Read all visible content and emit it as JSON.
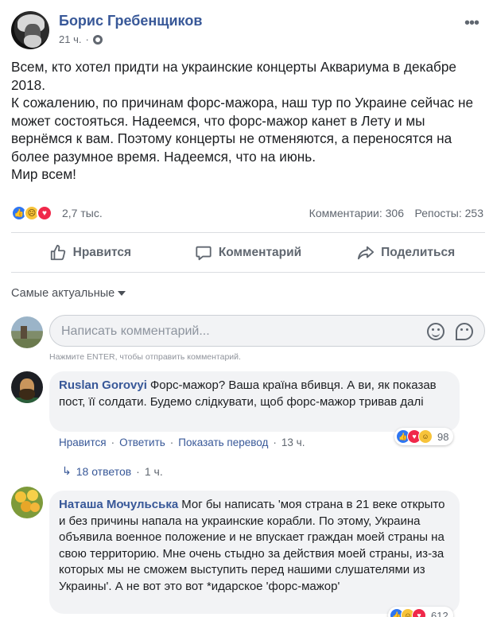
{
  "post": {
    "author": "Борис Гребенщиков",
    "time": "21 ч.",
    "meta_sep": "·",
    "text_lines": [
      "Всем, кто хотел придти на украинские концерты Аквариума в декабре 2018.",
      "К сожалению, по причинам форс-мажора, наш тур по Украине сейчас не может состояться. Надеемся, что форс-мажор канет в Лету и мы вернёмся к вам. Поэтому концерты не отменяются, а переносятся на более разумное время. Надеемся, что на июнь.",
      "Мир всем!"
    ],
    "reactions_count": "2,7 тыс.",
    "comments_count": "Комментарии: 306",
    "reposts_count": "Репосты: 253",
    "icons": [
      "like-icon",
      "sad-icon",
      "love-icon"
    ]
  },
  "actions": {
    "like": "Нравится",
    "comment": "Комментарий",
    "share": "Поделиться"
  },
  "sort_label": "Самые актуальные",
  "composer": {
    "placeholder": "Написать комментарий...",
    "hint": "Нажмите ENTER, чтобы отправить комментарий."
  },
  "comments": [
    {
      "name": "Ruslan Gorovyi",
      "text": "Форс-мажор? Ваша країна вбивця. А ви, як показав пост, її солдати. Будемо слідкувати, щоб форс-мажор тривав далі",
      "like": "Нравится",
      "reply": "Ответить",
      "translate": "Показать перевод",
      "time": "13 ч.",
      "reactions": "98",
      "replies_label": "18 ответов",
      "replies_time": "1 ч."
    },
    {
      "name": "Наташа Мочульська",
      "text": "Мог бы написать 'моя страна в 21 веке открыто и без причины напала на украинские корабли. По этому, Украина объявила военное положение и не впускает граждан моей страны на свою территорию. Мне очень стыдно за действия моей страны, из-за которых мы не сможем выступить перед нашими слушателями из Украины'. А не вот это вот *идарское 'форс-мажор'",
      "reactions": "612"
    }
  ],
  "colors": {
    "link": "#385898",
    "like": "#2e76f2",
    "love": "#f0284a",
    "haha_sad": "#f7c33a",
    "bubble": "#f2f3f5"
  }
}
